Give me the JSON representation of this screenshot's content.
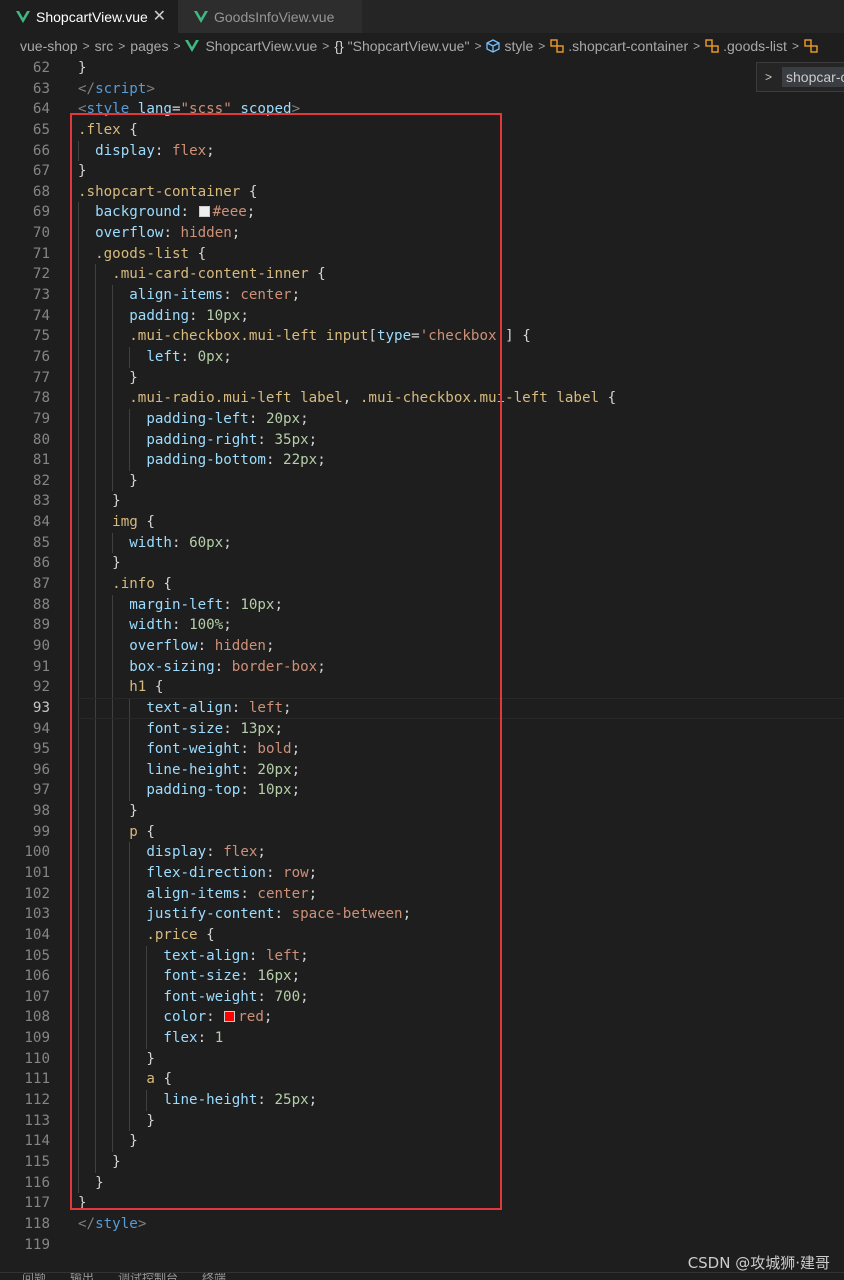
{
  "tabs": [
    {
      "label": "ShopcartView.vue",
      "active": true,
      "close": "✕",
      "icon": "vue-icon"
    },
    {
      "label": "GoodsInfoView.vue",
      "active": false,
      "icon": "vue-icon"
    }
  ],
  "breadcrumb": {
    "items": [
      "vue-shop",
      "src",
      "pages",
      "ShopcartView.vue",
      "\"ShopcartView.vue\"",
      "style",
      ".shopcart-container",
      ".goods-list"
    ],
    "separator": ">",
    "icons": {
      "file": "vue-icon",
      "component": "braces-icon",
      "style": "cube-icon",
      "selector": "symbol-icon"
    }
  },
  "sticky_scroll": {
    "label": "shopcar-c"
  },
  "editor": {
    "current_line": 93,
    "lines": [
      {
        "n": "62",
        "segs": [
          [
            "t-punc",
            "}"
          ]
        ]
      },
      {
        "n": "63",
        "segs": [
          [
            "t-ang",
            "</"
          ],
          [
            "t-tag",
            "script"
          ],
          [
            "t-ang",
            ">"
          ]
        ]
      },
      {
        "n": "64",
        "segs": [
          [
            "t-ang",
            "<"
          ],
          [
            "t-tag",
            "style "
          ],
          [
            "t-attr",
            "lang"
          ],
          [
            "t-punc",
            "="
          ],
          [
            "t-str",
            "\"scss\" "
          ],
          [
            "t-attr",
            "scoped"
          ],
          [
            "t-ang",
            ">"
          ]
        ]
      },
      {
        "n": "65",
        "segs": [
          [
            "t-sel",
            ".flex "
          ],
          [
            "t-punc",
            "{"
          ]
        ]
      },
      {
        "n": "66",
        "segs": [
          [
            "t-punc",
            "  "
          ],
          [
            "t-prop",
            "display"
          ],
          [
            "t-punc",
            ": "
          ],
          [
            "t-val",
            "flex"
          ],
          [
            "t-punc",
            ";"
          ]
        ]
      },
      {
        "n": "67",
        "segs": [
          [
            "t-punc",
            "}"
          ]
        ]
      },
      {
        "n": "68",
        "segs": [
          [
            "t-sel",
            ".shopcart-container "
          ],
          [
            "t-punc",
            "{"
          ]
        ]
      },
      {
        "n": "69",
        "segs": [
          [
            "t-punc",
            "  "
          ],
          [
            "t-prop",
            "background"
          ],
          [
            "t-punc",
            ": "
          ],
          [
            "swatch",
            "#eeeeee"
          ],
          [
            "t-val",
            "#eee"
          ],
          [
            "t-punc",
            ";"
          ]
        ]
      },
      {
        "n": "70",
        "segs": [
          [
            "t-punc",
            "  "
          ],
          [
            "t-prop",
            "overflow"
          ],
          [
            "t-punc",
            ": "
          ],
          [
            "t-val",
            "hidden"
          ],
          [
            "t-punc",
            ";"
          ]
        ]
      },
      {
        "n": "71",
        "segs": [
          [
            "t-punc",
            "  "
          ],
          [
            "t-sel",
            ".goods-list "
          ],
          [
            "t-punc",
            "{"
          ]
        ]
      },
      {
        "n": "72",
        "segs": [
          [
            "t-punc",
            "    "
          ],
          [
            "t-sel",
            ".mui-card-content-inner "
          ],
          [
            "t-punc",
            "{"
          ]
        ]
      },
      {
        "n": "73",
        "segs": [
          [
            "t-punc",
            "      "
          ],
          [
            "t-prop",
            "align-items"
          ],
          [
            "t-punc",
            ": "
          ],
          [
            "t-val",
            "center"
          ],
          [
            "t-punc",
            ";"
          ]
        ]
      },
      {
        "n": "74",
        "segs": [
          [
            "t-punc",
            "      "
          ],
          [
            "t-prop",
            "padding"
          ],
          [
            "t-punc",
            ": "
          ],
          [
            "t-num",
            "10px"
          ],
          [
            "t-punc",
            ";"
          ]
        ]
      },
      {
        "n": "75",
        "segs": [
          [
            "t-punc",
            "      "
          ],
          [
            "t-sel",
            ".mui-checkbox.mui-left input"
          ],
          [
            "t-punc",
            "["
          ],
          [
            "t-attr",
            "type"
          ],
          [
            "t-punc",
            "="
          ],
          [
            "t-str",
            "'checkbox'"
          ],
          [
            "t-punc",
            "] {"
          ]
        ]
      },
      {
        "n": "76",
        "segs": [
          [
            "t-punc",
            "        "
          ],
          [
            "t-prop",
            "left"
          ],
          [
            "t-punc",
            ": "
          ],
          [
            "t-num",
            "0px"
          ],
          [
            "t-punc",
            ";"
          ]
        ]
      },
      {
        "n": "77",
        "segs": [
          [
            "t-punc",
            "      }"
          ]
        ]
      },
      {
        "n": "78",
        "segs": [
          [
            "t-punc",
            "      "
          ],
          [
            "t-sel",
            ".mui-radio.mui-left label"
          ],
          [
            "t-punc",
            ", "
          ],
          [
            "t-sel",
            ".mui-checkbox.mui-left label "
          ],
          [
            "t-punc",
            "{"
          ]
        ]
      },
      {
        "n": "79",
        "segs": [
          [
            "t-punc",
            "        "
          ],
          [
            "t-prop",
            "padding-left"
          ],
          [
            "t-punc",
            ": "
          ],
          [
            "t-num",
            "20px"
          ],
          [
            "t-punc",
            ";"
          ]
        ]
      },
      {
        "n": "80",
        "segs": [
          [
            "t-punc",
            "        "
          ],
          [
            "t-prop",
            "padding-right"
          ],
          [
            "t-punc",
            ": "
          ],
          [
            "t-num",
            "35px"
          ],
          [
            "t-punc",
            ";"
          ]
        ]
      },
      {
        "n": "81",
        "segs": [
          [
            "t-punc",
            "        "
          ],
          [
            "t-prop",
            "padding-bottom"
          ],
          [
            "t-punc",
            ": "
          ],
          [
            "t-num",
            "22px"
          ],
          [
            "t-punc",
            ";"
          ]
        ]
      },
      {
        "n": "82",
        "segs": [
          [
            "t-punc",
            "      }"
          ]
        ]
      },
      {
        "n": "83",
        "segs": [
          [
            "t-punc",
            "    }"
          ]
        ]
      },
      {
        "n": "84",
        "segs": [
          [
            "t-punc",
            "    "
          ],
          [
            "t-sel",
            "img "
          ],
          [
            "t-punc",
            "{"
          ]
        ]
      },
      {
        "n": "85",
        "segs": [
          [
            "t-punc",
            "      "
          ],
          [
            "t-prop",
            "width"
          ],
          [
            "t-punc",
            ": "
          ],
          [
            "t-num",
            "60px"
          ],
          [
            "t-punc",
            ";"
          ]
        ]
      },
      {
        "n": "86",
        "segs": [
          [
            "t-punc",
            "    }"
          ]
        ]
      },
      {
        "n": "87",
        "segs": [
          [
            "t-punc",
            "    "
          ],
          [
            "t-sel",
            ".info "
          ],
          [
            "t-punc",
            "{"
          ]
        ]
      },
      {
        "n": "88",
        "segs": [
          [
            "t-punc",
            "      "
          ],
          [
            "t-prop",
            "margin-left"
          ],
          [
            "t-punc",
            ": "
          ],
          [
            "t-num",
            "10px"
          ],
          [
            "t-punc",
            ";"
          ]
        ]
      },
      {
        "n": "89",
        "segs": [
          [
            "t-punc",
            "      "
          ],
          [
            "t-prop",
            "width"
          ],
          [
            "t-punc",
            ": "
          ],
          [
            "t-num",
            "100%"
          ],
          [
            "t-punc",
            ";"
          ]
        ]
      },
      {
        "n": "90",
        "segs": [
          [
            "t-punc",
            "      "
          ],
          [
            "t-prop",
            "overflow"
          ],
          [
            "t-punc",
            ": "
          ],
          [
            "t-val",
            "hidden"
          ],
          [
            "t-punc",
            ";"
          ]
        ]
      },
      {
        "n": "91",
        "segs": [
          [
            "t-punc",
            "      "
          ],
          [
            "t-prop",
            "box-sizing"
          ],
          [
            "t-punc",
            ": "
          ],
          [
            "t-val",
            "border-box"
          ],
          [
            "t-punc",
            ";"
          ]
        ]
      },
      {
        "n": "92",
        "segs": [
          [
            "t-punc",
            "      "
          ],
          [
            "t-sel",
            "h1 "
          ],
          [
            "t-punc",
            "{"
          ]
        ]
      },
      {
        "n": "93",
        "segs": [
          [
            "t-punc",
            "        "
          ],
          [
            "t-prop",
            "text-align"
          ],
          [
            "t-punc",
            ": "
          ],
          [
            "t-val",
            "left"
          ],
          [
            "t-punc",
            ";"
          ]
        ]
      },
      {
        "n": "94",
        "segs": [
          [
            "t-punc",
            "        "
          ],
          [
            "t-prop",
            "font-size"
          ],
          [
            "t-punc",
            ": "
          ],
          [
            "t-num",
            "13px"
          ],
          [
            "t-punc",
            ";"
          ]
        ]
      },
      {
        "n": "95",
        "segs": [
          [
            "t-punc",
            "        "
          ],
          [
            "t-prop",
            "font-weight"
          ],
          [
            "t-punc",
            ": "
          ],
          [
            "t-val",
            "bold"
          ],
          [
            "t-punc",
            ";"
          ]
        ]
      },
      {
        "n": "96",
        "segs": [
          [
            "t-punc",
            "        "
          ],
          [
            "t-prop",
            "line-height"
          ],
          [
            "t-punc",
            ": "
          ],
          [
            "t-num",
            "20px"
          ],
          [
            "t-punc",
            ";"
          ]
        ]
      },
      {
        "n": "97",
        "segs": [
          [
            "t-punc",
            "        "
          ],
          [
            "t-prop",
            "padding-top"
          ],
          [
            "t-punc",
            ": "
          ],
          [
            "t-num",
            "10px"
          ],
          [
            "t-punc",
            ";"
          ]
        ]
      },
      {
        "n": "98",
        "segs": [
          [
            "t-punc",
            "      }"
          ]
        ]
      },
      {
        "n": "99",
        "segs": [
          [
            "t-punc",
            "      "
          ],
          [
            "t-sel",
            "p "
          ],
          [
            "t-punc",
            "{"
          ]
        ]
      },
      {
        "n": "100",
        "segs": [
          [
            "t-punc",
            "        "
          ],
          [
            "t-prop",
            "display"
          ],
          [
            "t-punc",
            ": "
          ],
          [
            "t-val",
            "flex"
          ],
          [
            "t-punc",
            ";"
          ]
        ]
      },
      {
        "n": "101",
        "segs": [
          [
            "t-punc",
            "        "
          ],
          [
            "t-prop",
            "flex-direction"
          ],
          [
            "t-punc",
            ": "
          ],
          [
            "t-val",
            "row"
          ],
          [
            "t-punc",
            ";"
          ]
        ]
      },
      {
        "n": "102",
        "segs": [
          [
            "t-punc",
            "        "
          ],
          [
            "t-prop",
            "align-items"
          ],
          [
            "t-punc",
            ": "
          ],
          [
            "t-val",
            "center"
          ],
          [
            "t-punc",
            ";"
          ]
        ]
      },
      {
        "n": "103",
        "segs": [
          [
            "t-punc",
            "        "
          ],
          [
            "t-prop",
            "justify-content"
          ],
          [
            "t-punc",
            ": "
          ],
          [
            "t-val",
            "space-between"
          ],
          [
            "t-punc",
            ";"
          ]
        ]
      },
      {
        "n": "104",
        "segs": [
          [
            "t-punc",
            "        "
          ],
          [
            "t-sel",
            ".price "
          ],
          [
            "t-punc",
            "{"
          ]
        ]
      },
      {
        "n": "105",
        "segs": [
          [
            "t-punc",
            "          "
          ],
          [
            "t-prop",
            "text-align"
          ],
          [
            "t-punc",
            ": "
          ],
          [
            "t-val",
            "left"
          ],
          [
            "t-punc",
            ";"
          ]
        ]
      },
      {
        "n": "106",
        "segs": [
          [
            "t-punc",
            "          "
          ],
          [
            "t-prop",
            "font-size"
          ],
          [
            "t-punc",
            ": "
          ],
          [
            "t-num",
            "16px"
          ],
          [
            "t-punc",
            ";"
          ]
        ]
      },
      {
        "n": "107",
        "segs": [
          [
            "t-punc",
            "          "
          ],
          [
            "t-prop",
            "font-weight"
          ],
          [
            "t-punc",
            ": "
          ],
          [
            "t-num",
            "700"
          ],
          [
            "t-punc",
            ";"
          ]
        ]
      },
      {
        "n": "108",
        "segs": [
          [
            "t-punc",
            "          "
          ],
          [
            "t-prop",
            "color"
          ],
          [
            "t-punc",
            ": "
          ],
          [
            "swatch",
            "#ff0000"
          ],
          [
            "t-val",
            "red"
          ],
          [
            "t-punc",
            ";"
          ]
        ]
      },
      {
        "n": "109",
        "segs": [
          [
            "t-punc",
            "          "
          ],
          [
            "t-prop",
            "flex"
          ],
          [
            "t-punc",
            ": "
          ],
          [
            "t-num",
            "1"
          ]
        ]
      },
      {
        "n": "110",
        "segs": [
          [
            "t-punc",
            "        }"
          ]
        ]
      },
      {
        "n": "111",
        "segs": [
          [
            "t-punc",
            "        "
          ],
          [
            "t-sel",
            "a "
          ],
          [
            "t-punc",
            "{"
          ]
        ]
      },
      {
        "n": "112",
        "segs": [
          [
            "t-punc",
            "          "
          ],
          [
            "t-prop",
            "line-height"
          ],
          [
            "t-punc",
            ": "
          ],
          [
            "t-num",
            "25px"
          ],
          [
            "t-punc",
            ";"
          ]
        ]
      },
      {
        "n": "113",
        "segs": [
          [
            "t-punc",
            "        }"
          ]
        ]
      },
      {
        "n": "114",
        "segs": [
          [
            "t-punc",
            "      }"
          ]
        ]
      },
      {
        "n": "115",
        "segs": [
          [
            "t-punc",
            "    }"
          ]
        ]
      },
      {
        "n": "116",
        "segs": [
          [
            "t-punc",
            "  }"
          ]
        ]
      },
      {
        "n": "117",
        "segs": [
          [
            "t-punc",
            "}"
          ]
        ]
      },
      {
        "n": "118",
        "segs": [
          [
            "t-ang",
            "</"
          ],
          [
            "t-tag",
            "style"
          ],
          [
            "t-ang",
            ">"
          ]
        ]
      },
      {
        "n": "119",
        "segs": []
      }
    ]
  },
  "watermark": "CSDN @攻城狮·建哥",
  "bottom_panel": {
    "items": [
      "问题",
      "输出",
      "调试控制台",
      "终端"
    ]
  },
  "colors": {
    "highlight_box": "#e0393b",
    "vue_green": "#41b883",
    "editor_bg": "#1e1e1e"
  }
}
